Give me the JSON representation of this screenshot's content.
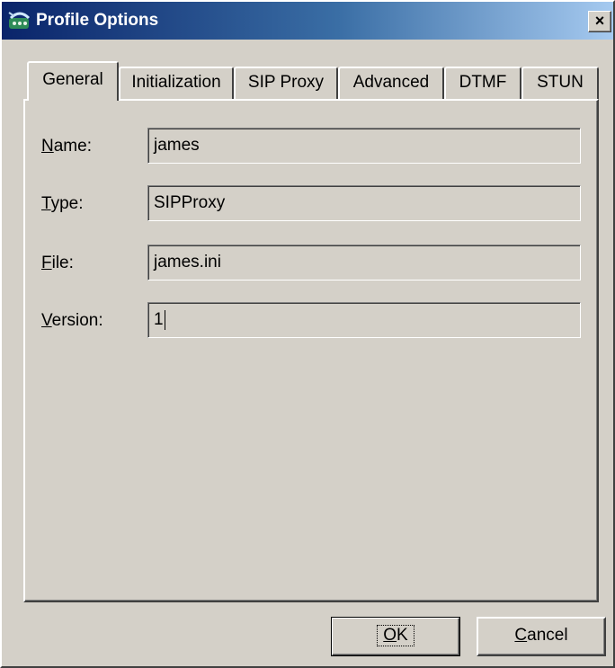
{
  "window": {
    "title": "Profile Options",
    "close_glyph": "×",
    "icon": "phone-settings-icon"
  },
  "tabs": [
    {
      "label": "General",
      "active": true
    },
    {
      "label": "Initialization",
      "active": false
    },
    {
      "label": "SIP Proxy",
      "active": false
    },
    {
      "label": "Advanced",
      "active": false
    },
    {
      "label": "DTMF",
      "active": false
    },
    {
      "label": "STUN",
      "active": false
    }
  ],
  "fields": {
    "name": {
      "label_key": "N",
      "label_rest": "ame:",
      "value": "james"
    },
    "type": {
      "label_key": "T",
      "label_rest": "ype:",
      "value": "SIPProxy"
    },
    "file": {
      "label_key": "F",
      "label_rest": "ile:",
      "value": "james.ini"
    },
    "version": {
      "label_key": "V",
      "label_rest": "ersion:",
      "value": "1"
    }
  },
  "buttons": {
    "ok": {
      "key": "O",
      "rest": "K"
    },
    "cancel": {
      "key": "C",
      "rest": "ancel"
    }
  },
  "colors": {
    "titlebar_start": "#0a246a",
    "titlebar_end": "#a6caf0",
    "face": "#d4d0c8"
  }
}
